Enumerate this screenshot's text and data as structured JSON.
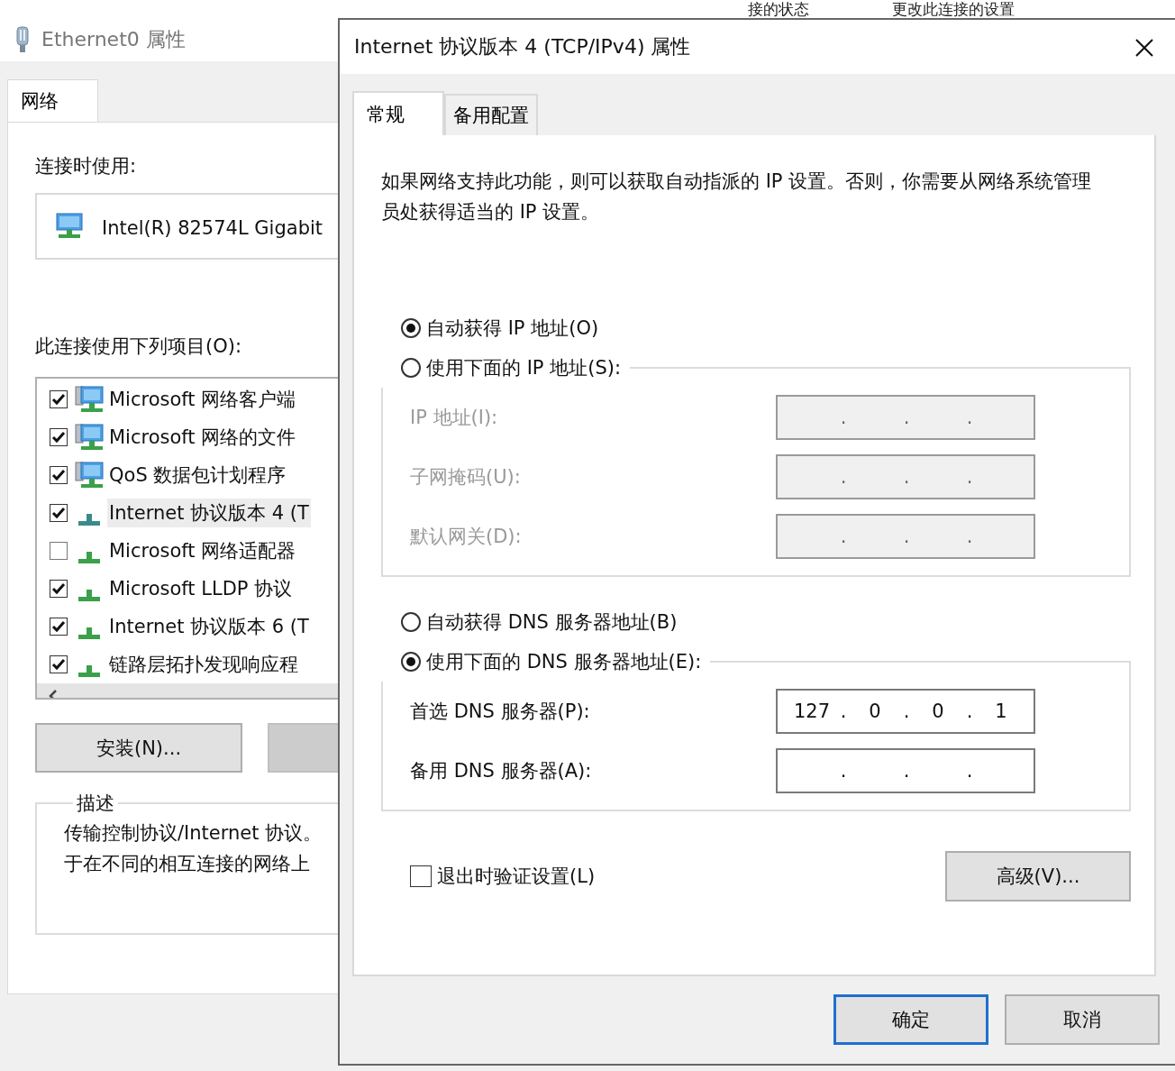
{
  "background_toolbar": [
    "接的状态",
    "更改此连接的设置"
  ],
  "background_window": {
    "title": "Ethernet0 属性",
    "tabs": [
      {
        "label": "网络",
        "selected": true
      }
    ],
    "connect_using_label": "连接时使用:",
    "adapter": "Intel(R) 82574L Gigabit",
    "items_label": "此连接使用下列项目(O):",
    "items": [
      {
        "label": "Microsoft 网络客户端",
        "kind": "service",
        "checked": true,
        "selected": false
      },
      {
        "label": "Microsoft 网络的文件",
        "kind": "service",
        "checked": true,
        "selected": false
      },
      {
        "label": "QoS 数据包计划程序",
        "kind": "service",
        "checked": true,
        "selected": false
      },
      {
        "label": "Internet 协议版本 4 (T",
        "kind": "protocol",
        "checked": true,
        "selected": true
      },
      {
        "label": "Microsoft 网络适配器",
        "kind": "protocol",
        "checked": false,
        "selected": false
      },
      {
        "label": "Microsoft LLDP 协议",
        "kind": "protocol",
        "checked": true,
        "selected": false
      },
      {
        "label": "Internet 协议版本 6 (T",
        "kind": "protocol",
        "checked": true,
        "selected": false
      },
      {
        "label": "链路层拓扑发现响应程",
        "kind": "protocol",
        "checked": true,
        "selected": false
      }
    ],
    "install_button": "安装(N)...",
    "description_label": "描述",
    "description_lines": [
      "传输控制协议/Internet 协议。",
      "于在不同的相互连接的网络上"
    ]
  },
  "dialog": {
    "title": "Internet 协议版本 4 (TCP/IPv4) 属性",
    "tabs": [
      {
        "label": "常规",
        "selected": true
      },
      {
        "label": "备用配置",
        "selected": false
      }
    ],
    "intro": "如果网络支持此功能，则可以获取自动指派的 IP 设置。否则，你需要从网络系统管理员处获得适当的 IP 设置。",
    "ip_separator": ".",
    "ip_groups": [
      {
        "auto_option": {
          "label": "自动获得 IP 地址(O)",
          "selected": true
        },
        "manual_option": {
          "label": "使用下面的 IP 地址(S):",
          "selected": false
        },
        "fields": [
          {
            "label": "IP 地址(I):",
            "disabled": true
          },
          {
            "label": "子网掩码(U):",
            "disabled": true
          },
          {
            "label": "默认网关(D):",
            "disabled": true
          }
        ]
      },
      {
        "auto_option": {
          "label": "自动获得 DNS 服务器地址(B)",
          "selected": false
        },
        "manual_option": {
          "label": "使用下面的 DNS 服务器地址(E):",
          "selected": true
        },
        "fields": [
          {
            "label": "首选 DNS 服务器(P):",
            "disabled": false,
            "octets": [
              "127",
              "0",
              "0",
              "1"
            ]
          },
          {
            "label": "备用 DNS 服务器(A):",
            "disabled": false
          }
        ]
      }
    ],
    "validate_checkbox": {
      "label": "退出时验证设置(L)",
      "checked": false
    },
    "advanced_button": "高级(V)...",
    "buttons": [
      {
        "label": "确定",
        "default": true
      },
      {
        "label": "取消",
        "default": false
      }
    ]
  }
}
